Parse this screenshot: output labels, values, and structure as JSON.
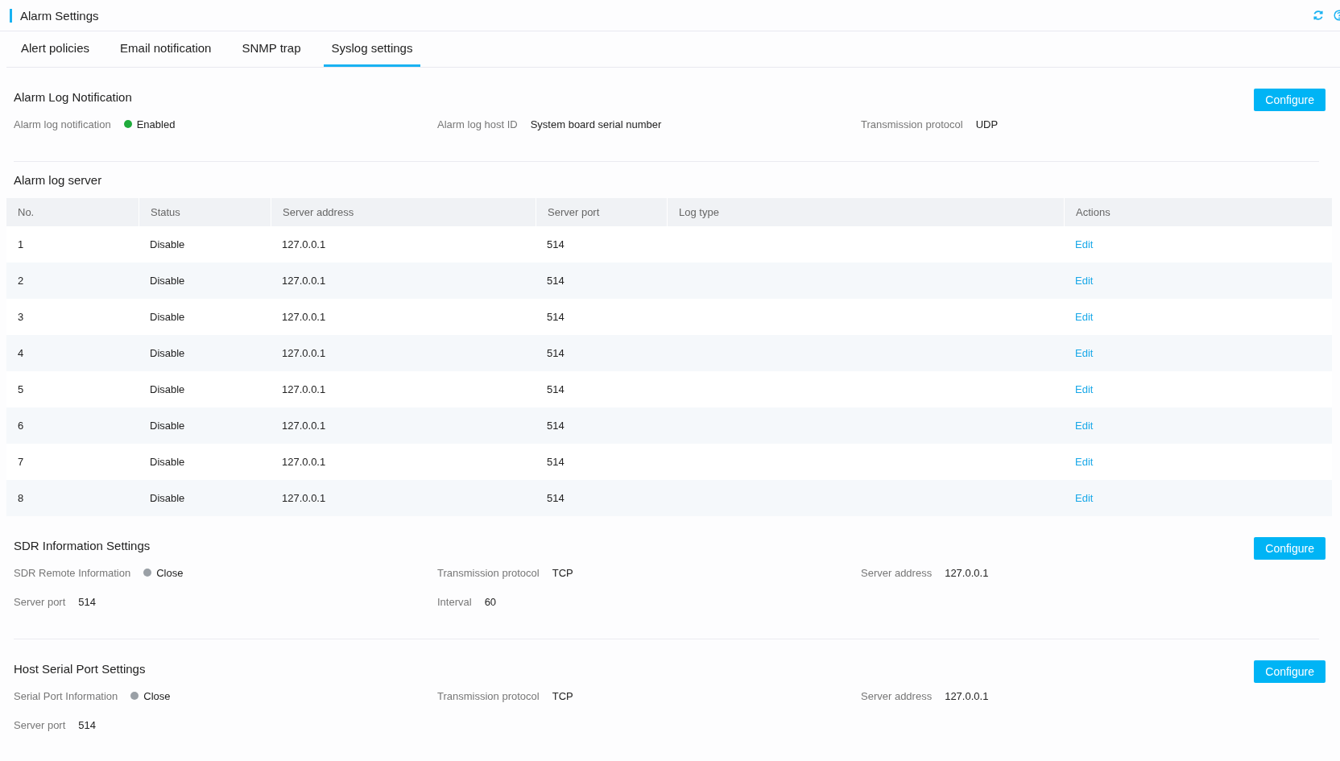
{
  "page": {
    "title": "Alarm Settings"
  },
  "tabs": [
    {
      "label": "Alert policies",
      "selected": false
    },
    {
      "label": "Email notification",
      "selected": false
    },
    {
      "label": "SNMP trap",
      "selected": false
    },
    {
      "label": "Syslog settings",
      "selected": true
    }
  ],
  "sections": [
    {
      "title": "Alarm Log Notification",
      "button": "Configure",
      "fields": [
        {
          "kind": "status",
          "label": "Alarm log notification",
          "value": "Enabled",
          "on": true
        },
        {
          "kind": "text",
          "label": "Alarm log host ID",
          "value": "System board serial number"
        },
        {
          "kind": "text",
          "label": "Transmission protocol",
          "value": "UDP"
        }
      ],
      "table": {
        "title": "Alarm log server",
        "columns": [
          "No.",
          "Status",
          "Server address",
          "Server port",
          "Log type",
          "Actions"
        ],
        "rows": [
          {
            "no": "1",
            "status": "Disable",
            "address": "127.0.0.1",
            "port": "514",
            "action": "Edit"
          },
          {
            "no": "2",
            "status": "Disable",
            "address": "127.0.0.1",
            "port": "514",
            "action": "Edit"
          },
          {
            "no": "3",
            "status": "Disable",
            "address": "127.0.0.1",
            "port": "514",
            "action": "Edit"
          },
          {
            "no": "4",
            "status": "Disable",
            "address": "127.0.0.1",
            "port": "514",
            "action": "Edit"
          },
          {
            "no": "5",
            "status": "Disable",
            "address": "127.0.0.1",
            "port": "514",
            "action": "Edit"
          },
          {
            "no": "6",
            "status": "Disable",
            "address": "127.0.0.1",
            "port": "514",
            "action": "Edit"
          },
          {
            "no": "7",
            "status": "Disable",
            "address": "127.0.0.1",
            "port": "514",
            "action": "Edit"
          },
          {
            "no": "8",
            "status": "Disable",
            "address": "127.0.0.1",
            "port": "514",
            "action": "Edit"
          }
        ]
      }
    },
    {
      "title": "SDR Information Settings",
      "button": "Configure",
      "fields": [
        {
          "kind": "status",
          "label": "SDR Remote Information",
          "value": "Close",
          "on": false
        },
        {
          "kind": "text",
          "label": "Transmission protocol",
          "value": "TCP"
        },
        {
          "kind": "text",
          "label": "Server address",
          "value": "127.0.0.1"
        },
        {
          "kind": "text",
          "label": "Server port",
          "value": "514"
        },
        {
          "kind": "text",
          "label": "Interval",
          "value": "60"
        }
      ]
    },
    {
      "title": "Host Serial Port Settings",
      "button": "Configure",
      "fields": [
        {
          "kind": "status",
          "label": "Serial Port Information",
          "value": "Close",
          "on": false
        },
        {
          "kind": "text",
          "label": "Transmission protocol",
          "value": "TCP"
        },
        {
          "kind": "text",
          "label": "Server address",
          "value": "127.0.0.1"
        },
        {
          "kind": "text",
          "label": "Server port",
          "value": "514"
        }
      ]
    }
  ]
}
